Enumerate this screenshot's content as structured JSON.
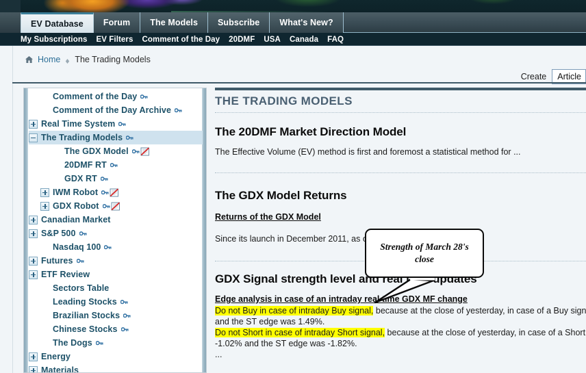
{
  "banner": {
    "alt": "site-banner-artwork"
  },
  "nav": {
    "tabs": [
      {
        "label": "EV Database",
        "active": true
      },
      {
        "label": "Forum",
        "active": false
      },
      {
        "label": "The Models",
        "active": false
      },
      {
        "label": "Subscribe",
        "active": false
      },
      {
        "label": "What's New?",
        "active": false
      }
    ],
    "subnav": [
      "My Subscriptions",
      "EV Filters",
      "Comment of the Day",
      "20DMF",
      "USA",
      "Canada",
      "FAQ"
    ]
  },
  "breadcrumb": {
    "home_icon": "home-icon",
    "home": "Home",
    "separator_icon": "diamond-separator-icon",
    "current": "The Trading Models"
  },
  "toolbar": {
    "create_label": "Create",
    "article_select_value": "Article"
  },
  "sidebar": {
    "items": [
      {
        "label": "Comment of the Day",
        "indent": 1,
        "toggle": "none",
        "key": true,
        "book": false,
        "selected": false
      },
      {
        "label": "Comment of the Day Archive",
        "indent": 1,
        "toggle": "none",
        "key": true,
        "book": false,
        "selected": false
      },
      {
        "label": "Real Time System",
        "indent": 0,
        "toggle": "plus",
        "key": true,
        "book": false,
        "selected": false
      },
      {
        "label": "The Trading Models",
        "indent": 0,
        "toggle": "minus",
        "key": true,
        "book": false,
        "selected": true
      },
      {
        "label": "The GDX Model",
        "indent": 2,
        "toggle": "none",
        "key": true,
        "book": true,
        "selected": false
      },
      {
        "label": "20DMF RT",
        "indent": 2,
        "toggle": "none",
        "key": true,
        "book": false,
        "selected": false
      },
      {
        "label": "GDX RT",
        "indent": 2,
        "toggle": "none",
        "key": true,
        "book": false,
        "selected": false
      },
      {
        "label": "IWM Robot",
        "indent": 1,
        "toggle": "plus",
        "key": true,
        "book": true,
        "selected": false
      },
      {
        "label": "GDX Robot",
        "indent": 1,
        "toggle": "plus",
        "key": true,
        "book": true,
        "selected": false
      },
      {
        "label": "Canadian Market",
        "indent": 0,
        "toggle": "plus",
        "key": false,
        "book": false,
        "selected": false
      },
      {
        "label": "S&P 500",
        "indent": 0,
        "toggle": "plus",
        "key": true,
        "book": false,
        "selected": false
      },
      {
        "label": "Nasdaq 100",
        "indent": 1,
        "toggle": "none",
        "key": true,
        "book": false,
        "selected": false
      },
      {
        "label": "Futures",
        "indent": 0,
        "toggle": "plus",
        "key": true,
        "book": false,
        "selected": false
      },
      {
        "label": "ETF Review",
        "indent": 0,
        "toggle": "plus",
        "key": false,
        "book": false,
        "selected": false
      },
      {
        "label": "Sectors Table",
        "indent": 1,
        "toggle": "none",
        "key": false,
        "book": false,
        "selected": false
      },
      {
        "label": "Leading Stocks",
        "indent": 1,
        "toggle": "none",
        "key": true,
        "book": false,
        "selected": false
      },
      {
        "label": "Brazilian Stocks",
        "indent": 1,
        "toggle": "none",
        "key": true,
        "book": false,
        "selected": false
      },
      {
        "label": "Chinese Stocks",
        "indent": 1,
        "toggle": "none",
        "key": true,
        "book": false,
        "selected": false
      },
      {
        "label": "The Dogs",
        "indent": 1,
        "toggle": "none",
        "key": true,
        "book": false,
        "selected": false
      },
      {
        "label": "Energy",
        "indent": 0,
        "toggle": "plus",
        "key": false,
        "book": false,
        "selected": false
      },
      {
        "label": "Materials",
        "indent": 0,
        "toggle": "plus",
        "key": false,
        "book": false,
        "selected": false
      }
    ]
  },
  "main": {
    "page_title": "THE TRADING MODELS",
    "sections": {
      "dmf_heading": "The 20DMF Market Direction Model",
      "dmf_paragraph": "The Effective Volume (EV) method is first and foremost a statistical method for ...",
      "gdx_returns_heading": "The GDX Model Returns",
      "gdx_returns_link": "Returns of the GDX Model",
      "gdx_returns_paragraph": "Since its launch in December 2011, as o",
      "signal_heading": "GDX Signal strength level and real time updates",
      "edge_heading": "Edge analysis in case of an intraday real time GDX MF change",
      "edge_line1_highlight": "Do not Buy in case of intraday Buy signal,",
      "edge_line1_rest": " because at the close of yesterday, in case of a Buy signal",
      "edge_line2": "and the ST edge was 1.49%.",
      "edge_line3_highlight": "Do not Short in case of intraday Short signal,",
      "edge_line3_rest": " because at the close of yesterday, in case of a Short",
      "edge_line4": "-1.02% and the ST edge was -1.82%.",
      "edge_ellipsis": "..."
    }
  },
  "callout": {
    "text": "Strength of March 28's close"
  },
  "colors": {
    "nav_dark": "#0f2630",
    "tab_active_bg": "#eef4f7",
    "tab_accent": "#3c7f99",
    "sidebar_selected": "#cfe2ee",
    "link": "#2d6f97",
    "heading": "#4a6072",
    "highlight": "#ffff00",
    "rule": "#3f5a69"
  }
}
